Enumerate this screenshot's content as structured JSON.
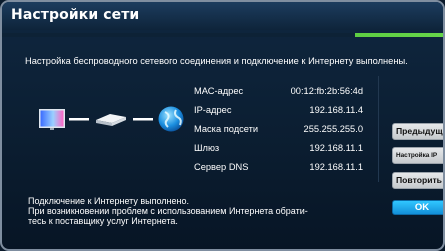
{
  "window": {
    "title": "Настройки сети",
    "progress": 1.0
  },
  "main": {
    "message": "Настройка беспроводного сетевого соединения и подключение к Интернету выполнены."
  },
  "info": [
    {
      "label": "МАС-адрес",
      "value": "00:12:fb:2b:56:4d"
    },
    {
      "label": "IP-адрес",
      "value": "192.168.11.4"
    },
    {
      "label": "Маска подсети",
      "value": "255.255.255.0"
    },
    {
      "label": "Шлюз",
      "value": "192.168.11.1"
    },
    {
      "label": "Сервер DNS",
      "value": "192.168.11.1"
    }
  ],
  "status": {
    "line1": "Подключение к Интернету выполнено.",
    "line2": "При возникновении проблем с использованием Интернета обрати-",
    "line3": "тесь к поставщику услуг Интернета."
  },
  "buttons": {
    "previous": "Предыдущ.",
    "ip_settings": "Настройка IP",
    "retry": "Повторить",
    "ok": "OK"
  },
  "icons": {
    "tv": "tv-icon",
    "router": "router-icon",
    "internet": "globe-icon"
  },
  "colors": {
    "progress": "#5ccf3f",
    "ok_button": "#1fa9ef"
  }
}
